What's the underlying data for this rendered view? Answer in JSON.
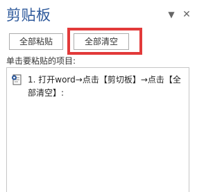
{
  "pane": {
    "title": "剪贴板",
    "dropdown_glyph": "▼",
    "close_glyph": "✕"
  },
  "toolbar": {
    "paste_all_label": "全部粘贴",
    "clear_all_label": "全部清空"
  },
  "hint": "单击要粘贴的项目:",
  "items": [
    {
      "text": "1. 打开word→点击【剪切板】→点击【全部清空】:",
      "icon": "word-document-icon"
    }
  ],
  "colors": {
    "title": "#2b579a",
    "highlight": "#e23a3a",
    "button_border": "#ababab",
    "list_border": "#c6c6c6"
  }
}
